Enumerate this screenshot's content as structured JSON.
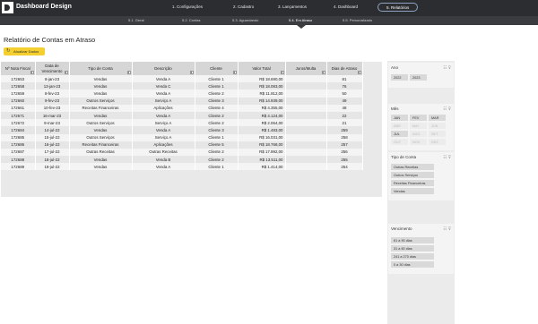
{
  "app": {
    "title": "Dashboard Design"
  },
  "nav": {
    "tabs": [
      {
        "label": "1. Configurações"
      },
      {
        "label": "2. Cadastro"
      },
      {
        "label": "3. Lançamentos"
      },
      {
        "label": "4. Dashboard"
      },
      {
        "label": "5. Relatórios",
        "active": true
      }
    ],
    "subtabs": [
      {
        "label": "5.1. Geral"
      },
      {
        "label": "5.2. Contas"
      },
      {
        "label": "5.3. Aguardando"
      },
      {
        "label": "5.4. Em Atraso",
        "active": true
      },
      {
        "label": "5.5. Personalizado"
      }
    ]
  },
  "page": {
    "title": "Relatório de Contas em Atraso",
    "refresh_label": "Atualizar Dados"
  },
  "table": {
    "columns": [
      "Nº Nota Fiscal",
      "Data de Vencimento",
      "Tipo de Conta",
      "Descrição",
      "Cliente",
      "Valor Total",
      "Juros/Multa",
      "Dias de Atraso"
    ],
    "rows": [
      [
        "172653",
        "8-jan-23",
        "Vendas",
        "Venda A",
        "Cliente 1",
        "R$ 18.690,00",
        "",
        "81"
      ],
      [
        "172658",
        "13-jan-23",
        "Vendas",
        "Venda C",
        "Cliente 1",
        "R$ 18.083,00",
        "",
        "76"
      ],
      [
        "172659",
        "8-fev-23",
        "Vendas",
        "Venda A",
        "Cliente 2",
        "R$ 11.812,00",
        "",
        "50"
      ],
      [
        "172660",
        "9-fev-23",
        "Outros Serviços",
        "Serviço A",
        "Cliente 3",
        "R$ 14.939,00",
        "",
        "49"
      ],
      [
        "172661",
        "10-fev-23",
        "Receitas Financeiras",
        "Aplicações",
        "Cliente 4",
        "R$ 4.355,00",
        "",
        "48"
      ],
      [
        "172671",
        "16-mar-23",
        "Vendas",
        "Venda A",
        "Cliente 2",
        "R$ 4.124,00",
        "",
        "22"
      ],
      [
        "172672",
        "9-mar-23",
        "Outros Serviços",
        "Serviço A",
        "Cliente 2",
        "R$ 2.064,00",
        "",
        "21"
      ],
      [
        "172684",
        "14-jul-22",
        "Vendas",
        "Venda A",
        "Cliente 3",
        "R$ 1.483,00",
        "",
        "259"
      ],
      [
        "172685",
        "15-jul-22",
        "Outros Serviços",
        "Serviço A",
        "Cliente 1",
        "R$ 16.031,00",
        "",
        "258"
      ],
      [
        "172686",
        "16-jul-22",
        "Receitas Financeiras",
        "Aplicações",
        "Cliente 5",
        "R$ 18.768,00",
        "",
        "257"
      ],
      [
        "172687",
        "17-jul-22",
        "Outras Receitas",
        "Outras Receitas",
        "Cliente 2",
        "R$ 17.992,00",
        "",
        "256"
      ],
      [
        "172688",
        "18-jul-22",
        "Vendas",
        "Venda B",
        "Cliente 2",
        "R$ 13.511,00",
        "",
        "255"
      ],
      [
        "172689",
        "19-jul-22",
        "Vendas",
        "Venda A",
        "Cliente 1",
        "R$ 1.414,00",
        "",
        "254"
      ]
    ]
  },
  "slicers": {
    "ano": {
      "title": "Ano",
      "items": [
        "2022",
        "2023"
      ]
    },
    "mes": {
      "title": "Mês",
      "items": [
        "JAN",
        "FEV",
        "MAR",
        "ABR",
        "MAI",
        "JUN",
        "JUL",
        "AGO",
        "SET",
        "OUT",
        "NOV",
        "DEZ"
      ]
    },
    "tipo": {
      "title": "Tipo de Conta",
      "items": [
        "Outras Receitas",
        "Outros Serviços",
        "Receitas Financeiras",
        "Vendas"
      ]
    },
    "vencimento": {
      "title": "Vencimento",
      "items": [
        "61 a 90 dias",
        "31 a 60 dias",
        "241 a 270 dias",
        "0 a 30 dias"
      ]
    }
  },
  "icons": {
    "logo": "logo-icon",
    "refresh": "refresh-icon",
    "multiselect": "multiselect-icon",
    "filter": "filter-clear-icon",
    "dropdown": "dropdown-arrow-icon"
  },
  "colors": {
    "topbar": "#2b2d31",
    "subbar": "#3a3c40",
    "accent": "#f5cf2e",
    "active_tab_border": "#8fa3c0"
  }
}
